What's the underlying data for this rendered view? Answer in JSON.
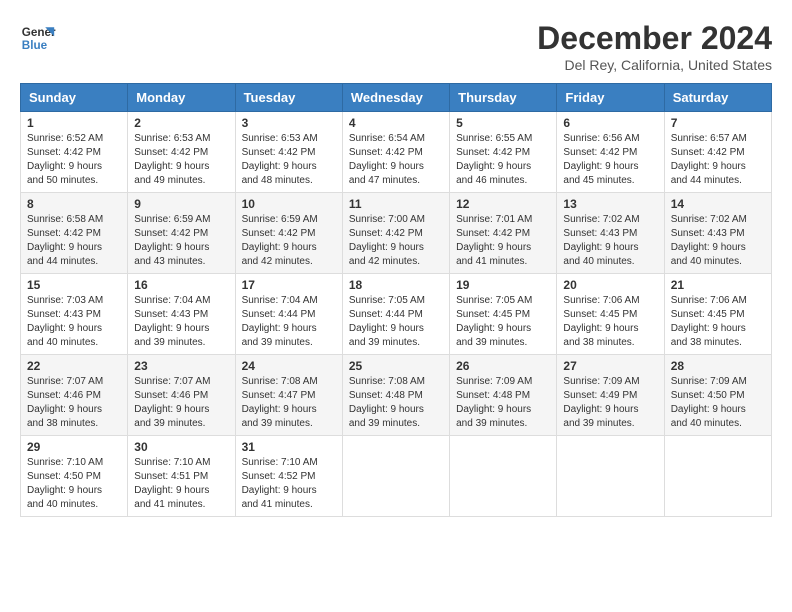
{
  "logo": {
    "line1": "General",
    "line2": "Blue"
  },
  "title": "December 2024",
  "subtitle": "Del Rey, California, United States",
  "weekdays": [
    "Sunday",
    "Monday",
    "Tuesday",
    "Wednesday",
    "Thursday",
    "Friday",
    "Saturday"
  ],
  "weeks": [
    [
      {
        "day": "1",
        "sunrise": "6:52 AM",
        "sunset": "4:42 PM",
        "daylight": "9 hours and 50 minutes"
      },
      {
        "day": "2",
        "sunrise": "6:53 AM",
        "sunset": "4:42 PM",
        "daylight": "9 hours and 49 minutes"
      },
      {
        "day": "3",
        "sunrise": "6:53 AM",
        "sunset": "4:42 PM",
        "daylight": "9 hours and 48 minutes"
      },
      {
        "day": "4",
        "sunrise": "6:54 AM",
        "sunset": "4:42 PM",
        "daylight": "9 hours and 47 minutes"
      },
      {
        "day": "5",
        "sunrise": "6:55 AM",
        "sunset": "4:42 PM",
        "daylight": "9 hours and 46 minutes"
      },
      {
        "day": "6",
        "sunrise": "6:56 AM",
        "sunset": "4:42 PM",
        "daylight": "9 hours and 45 minutes"
      },
      {
        "day": "7",
        "sunrise": "6:57 AM",
        "sunset": "4:42 PM",
        "daylight": "9 hours and 44 minutes"
      }
    ],
    [
      {
        "day": "8",
        "sunrise": "6:58 AM",
        "sunset": "4:42 PM",
        "daylight": "9 hours and 44 minutes"
      },
      {
        "day": "9",
        "sunrise": "6:59 AM",
        "sunset": "4:42 PM",
        "daylight": "9 hours and 43 minutes"
      },
      {
        "day": "10",
        "sunrise": "6:59 AM",
        "sunset": "4:42 PM",
        "daylight": "9 hours and 42 minutes"
      },
      {
        "day": "11",
        "sunrise": "7:00 AM",
        "sunset": "4:42 PM",
        "daylight": "9 hours and 42 minutes"
      },
      {
        "day": "12",
        "sunrise": "7:01 AM",
        "sunset": "4:42 PM",
        "daylight": "9 hours and 41 minutes"
      },
      {
        "day": "13",
        "sunrise": "7:02 AM",
        "sunset": "4:43 PM",
        "daylight": "9 hours and 40 minutes"
      },
      {
        "day": "14",
        "sunrise": "7:02 AM",
        "sunset": "4:43 PM",
        "daylight": "9 hours and 40 minutes"
      }
    ],
    [
      {
        "day": "15",
        "sunrise": "7:03 AM",
        "sunset": "4:43 PM",
        "daylight": "9 hours and 40 minutes"
      },
      {
        "day": "16",
        "sunrise": "7:04 AM",
        "sunset": "4:43 PM",
        "daylight": "9 hours and 39 minutes"
      },
      {
        "day": "17",
        "sunrise": "7:04 AM",
        "sunset": "4:44 PM",
        "daylight": "9 hours and 39 minutes"
      },
      {
        "day": "18",
        "sunrise": "7:05 AM",
        "sunset": "4:44 PM",
        "daylight": "9 hours and 39 minutes"
      },
      {
        "day": "19",
        "sunrise": "7:05 AM",
        "sunset": "4:45 PM",
        "daylight": "9 hours and 39 minutes"
      },
      {
        "day": "20",
        "sunrise": "7:06 AM",
        "sunset": "4:45 PM",
        "daylight": "9 hours and 38 minutes"
      },
      {
        "day": "21",
        "sunrise": "7:06 AM",
        "sunset": "4:45 PM",
        "daylight": "9 hours and 38 minutes"
      }
    ],
    [
      {
        "day": "22",
        "sunrise": "7:07 AM",
        "sunset": "4:46 PM",
        "daylight": "9 hours and 38 minutes"
      },
      {
        "day": "23",
        "sunrise": "7:07 AM",
        "sunset": "4:46 PM",
        "daylight": "9 hours and 39 minutes"
      },
      {
        "day": "24",
        "sunrise": "7:08 AM",
        "sunset": "4:47 PM",
        "daylight": "9 hours and 39 minutes"
      },
      {
        "day": "25",
        "sunrise": "7:08 AM",
        "sunset": "4:48 PM",
        "daylight": "9 hours and 39 minutes"
      },
      {
        "day": "26",
        "sunrise": "7:09 AM",
        "sunset": "4:48 PM",
        "daylight": "9 hours and 39 minutes"
      },
      {
        "day": "27",
        "sunrise": "7:09 AM",
        "sunset": "4:49 PM",
        "daylight": "9 hours and 39 minutes"
      },
      {
        "day": "28",
        "sunrise": "7:09 AM",
        "sunset": "4:50 PM",
        "daylight": "9 hours and 40 minutes"
      }
    ],
    [
      {
        "day": "29",
        "sunrise": "7:10 AM",
        "sunset": "4:50 PM",
        "daylight": "9 hours and 40 minutes"
      },
      {
        "day": "30",
        "sunrise": "7:10 AM",
        "sunset": "4:51 PM",
        "daylight": "9 hours and 41 minutes"
      },
      {
        "day": "31",
        "sunrise": "7:10 AM",
        "sunset": "4:52 PM",
        "daylight": "9 hours and 41 minutes"
      },
      null,
      null,
      null,
      null
    ]
  ]
}
